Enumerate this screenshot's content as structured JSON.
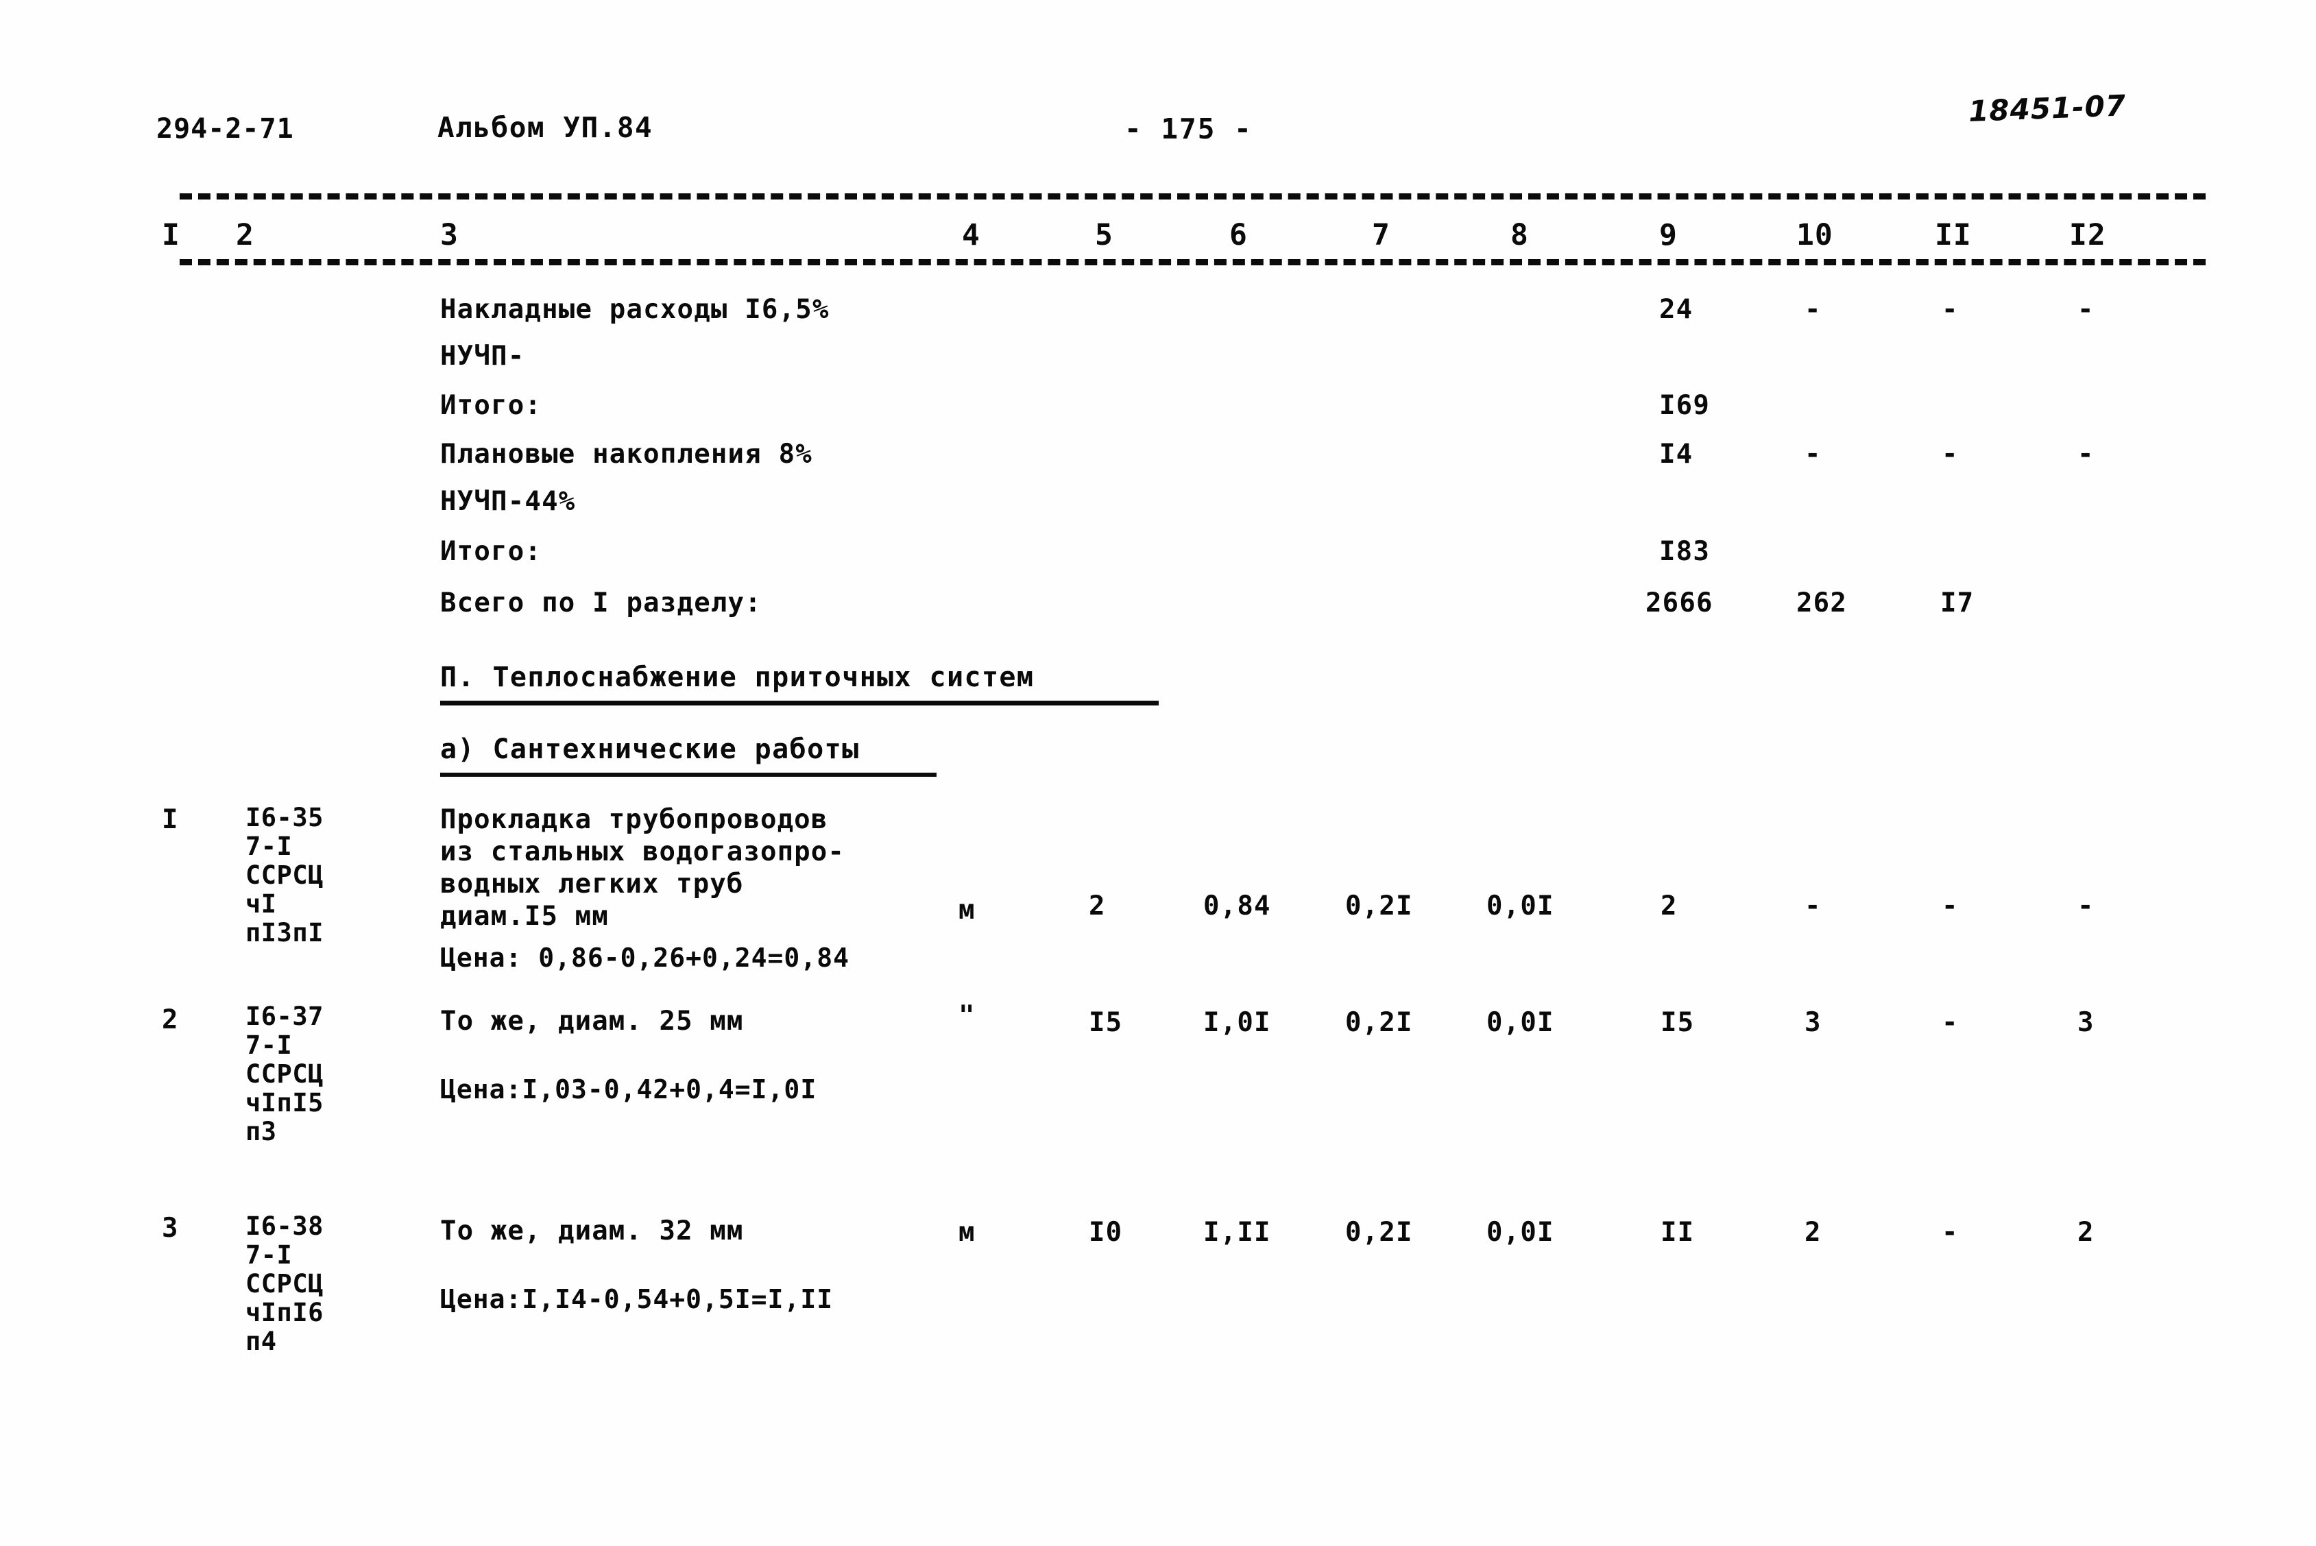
{
  "header": {
    "doc_code": "294-2-71",
    "album_title": "Альбом УП.84",
    "page_number": "- 175 -",
    "stamp_number": "18451-07"
  },
  "table": {
    "column_headers": [
      "I",
      "2",
      "3",
      "4",
      "5",
      "6",
      "7",
      "8",
      "9",
      "10",
      "II",
      "I2"
    ],
    "summary_rows": [
      {
        "label": "Накладные расходы I6,5%",
        "label2": "НУЧП-",
        "col9": "24",
        "col10": "-",
        "col11": "-",
        "col12": "-"
      },
      {
        "label": "Итого:",
        "col9": "I69"
      },
      {
        "label": "Плановые накопления 8%",
        "label2": "НУЧП-44%",
        "col9": "I4",
        "col10": "-",
        "col11": "-",
        "col12": "-"
      },
      {
        "label": "Итого:",
        "col9": "I83"
      },
      {
        "label": "Всего по I разделу:",
        "col9": "2666",
        "col10": "262",
        "col11": "I7"
      }
    ],
    "section_heading": "П. Теплоснабжение приточных систем",
    "subsection_heading": "а) Сантехнические работы",
    "work_rows": [
      {
        "num": "I",
        "code": "I6-35\n7-I\nССРСЦ\nчI\nпI3пI",
        "description": "Прокладка трубопроводов\nиз стальных водогазопро-\nводных легких труб\nдиам.I5 мм",
        "price_note": "Цена: 0,86-0,26+0,24=0,84",
        "unit": "м",
        "qty": "2",
        "col6": "0,84",
        "col7": "0,2I",
        "col8": "0,0I",
        "col9": "2",
        "col10": "-",
        "col11": "-",
        "col12": "-"
      },
      {
        "num": "2",
        "code": "I6-37\n7-I\nССРСЦ\nчIпI5\nп3",
        "description": "То же, диам. 25 мм",
        "price_note": "Цена:I,03-0,42+0,4=I,0I",
        "unit": "\"",
        "qty": "I5",
        "col6": "I,0I",
        "col7": "0,2I",
        "col8": "0,0I",
        "col9": "I5",
        "col10": "3",
        "col11": "-",
        "col12": "3"
      },
      {
        "num": "3",
        "code": "I6-38\n7-I\nССРСЦ\nчIпI6\nп4",
        "description": "То же, диам. 32 мм",
        "price_note": "Цена:I,I4-0,54+0,5I=I,II",
        "unit": "м",
        "qty": "I0",
        "col6": "I,II",
        "col7": "0,2I",
        "col8": "0,0I",
        "col9": "II",
        "col10": "2",
        "col11": "-",
        "col12": "2"
      }
    ]
  }
}
